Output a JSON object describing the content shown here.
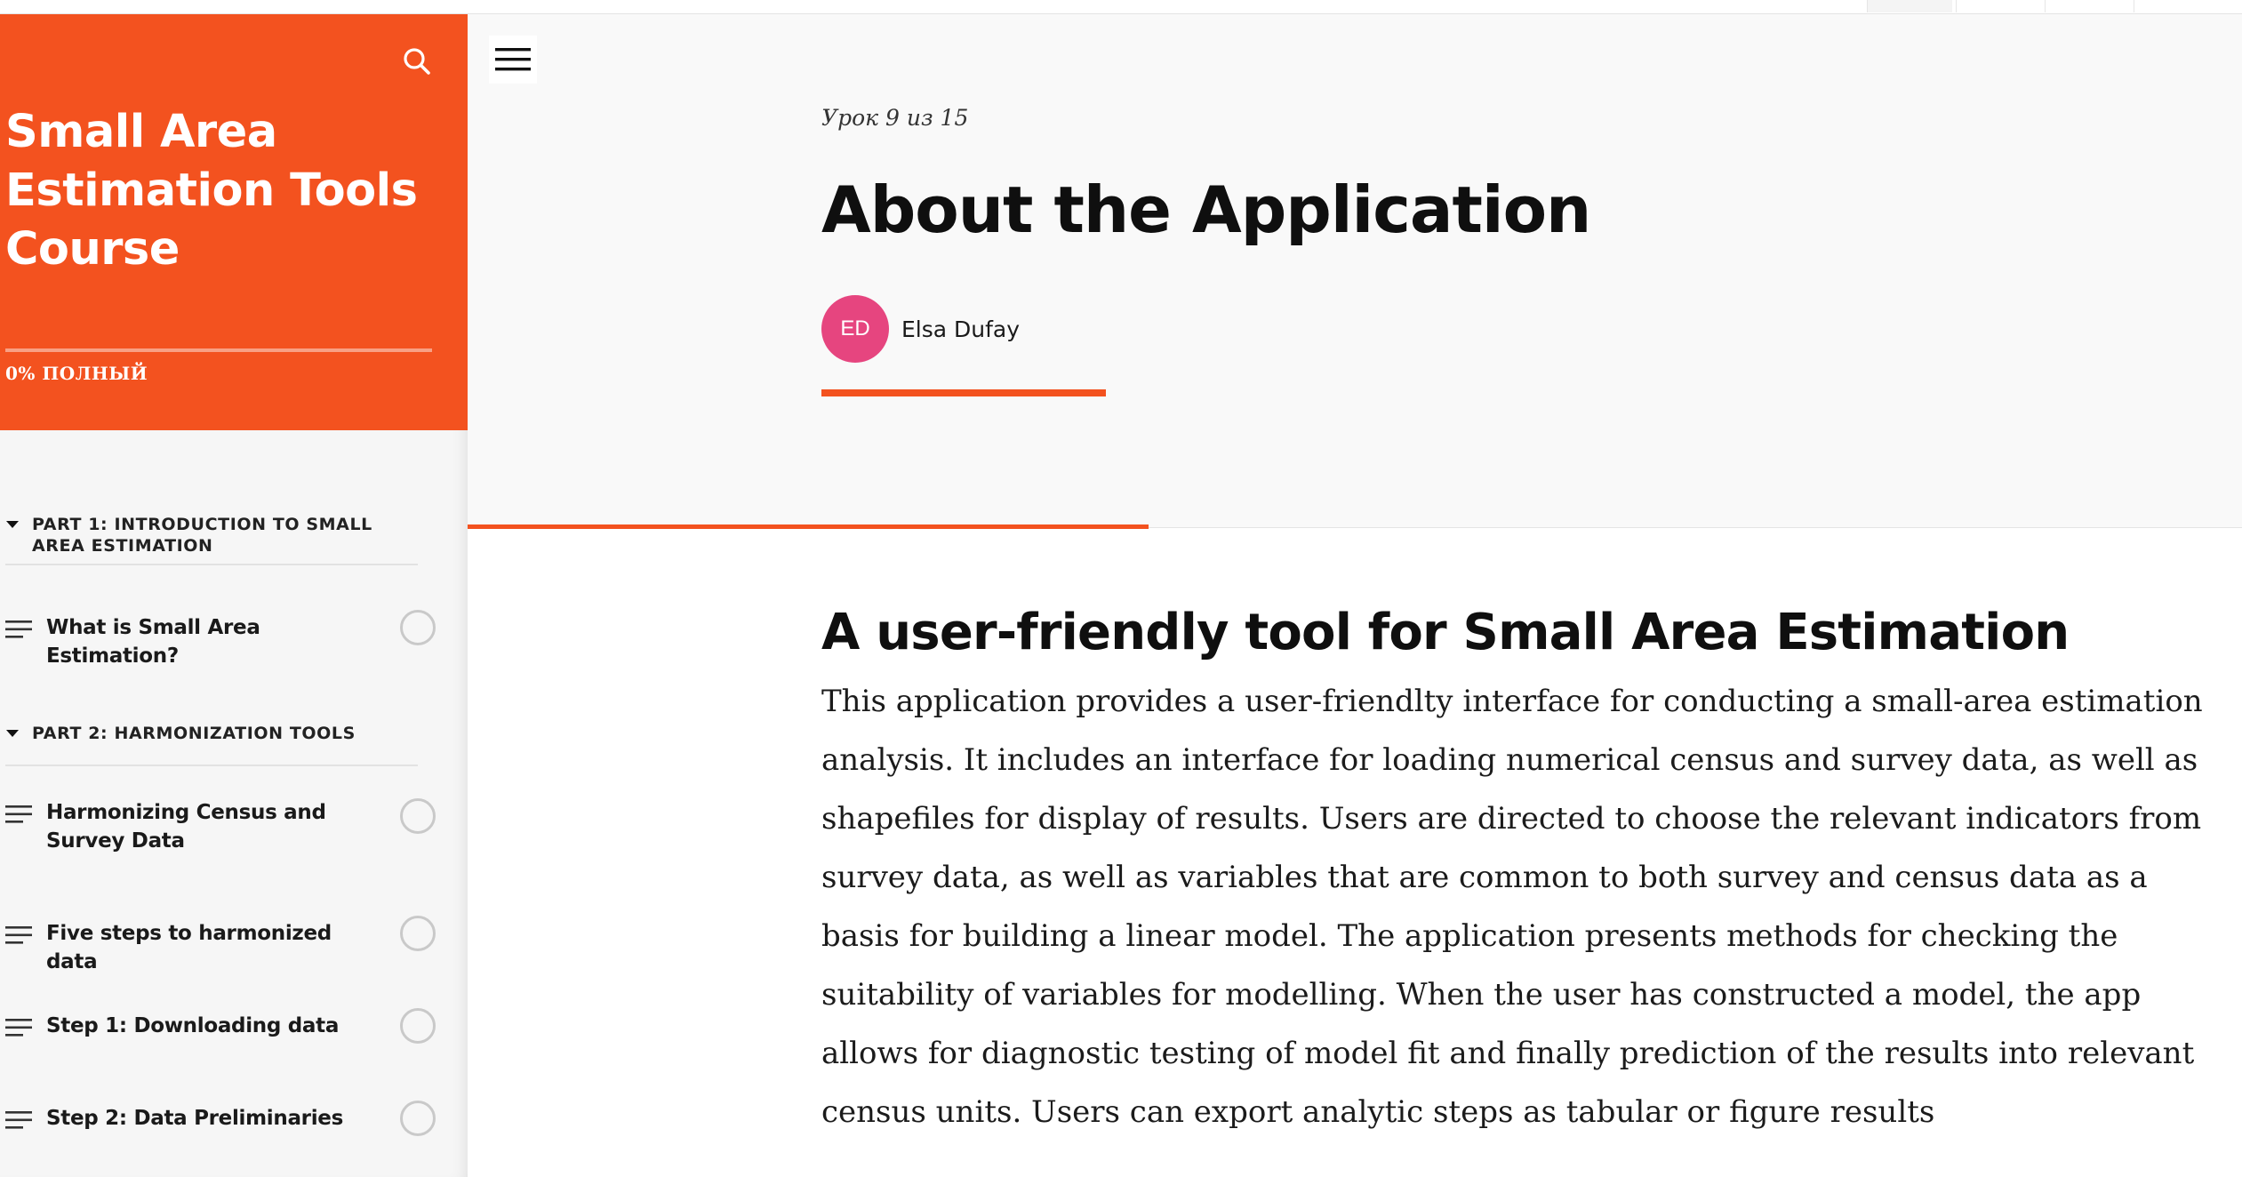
{
  "sidebar": {
    "course_title": "Small Area Estimation Tools Course",
    "progress_label": "0% ПОЛНЫЙ",
    "progress_value": 0,
    "sections": [
      {
        "title": "PART 1: INTRODUCTION TO SMALL AREA ESTIMATION",
        "lessons": [
          {
            "label": "What is Small Area Estimation?"
          }
        ]
      },
      {
        "title": "PART 2: HARMONIZATION TOOLS",
        "lessons": [
          {
            "label": "Harmonizing Census and Survey Data"
          },
          {
            "label": "Five steps to harmonized data"
          },
          {
            "label": "Step 1: Downloading data"
          },
          {
            "label": "Step 2: Data Preliminaries"
          }
        ]
      }
    ]
  },
  "lesson": {
    "counter": "Урок 9 из 15",
    "title": "About the Application",
    "author_initials": "ED",
    "author_name": "Elsa Dufay",
    "heading": "A user-friendly tool for Small Area Estimation",
    "body": "This application provides a user-friendlty interface for conducting a small-area estimation analysis. It includes an interface for loading numerical census and survey data, as well as shapefiles for display of results. Users are directed to choose the relevant indicators from survey data, as well as variables that are common to both survey and census data as a basis for building a linear model. The application presents methods for checking the suitability of variables for modelling. When the user has constructed a model, the app allows for diagnostic testing of model fit and finally prediction of the results into relevant census units. Users can export analytic steps as tabular or figure results"
  },
  "colors": {
    "accent": "#f3521f",
    "avatar": "#e6457f"
  },
  "icons": {
    "search": "search-icon",
    "menu": "hamburger-menu-icon",
    "section_toggle": "caret-down-icon",
    "lesson": "lesson-lines-icon",
    "status": "status-circle-icon"
  }
}
